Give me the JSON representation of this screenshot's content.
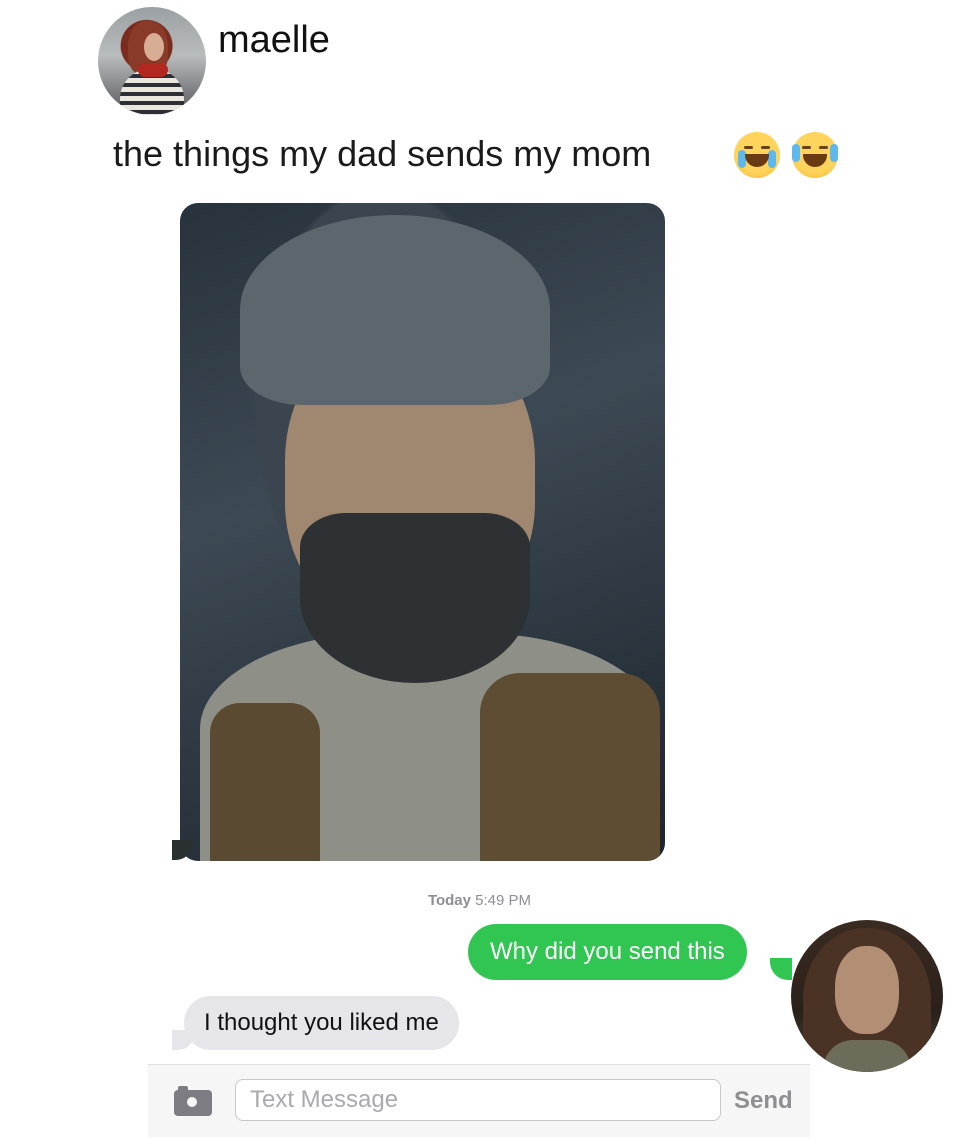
{
  "post": {
    "username": "maelle",
    "caption": "the things my dad sends my mom"
  },
  "emojis": [
    "loudly-crying-face-icon",
    "face-with-tears-of-joy-icon"
  ],
  "conversation": {
    "timestamp_day": "Today",
    "timestamp_time": "5:49 PM",
    "sent_message": "Why did you send this",
    "received_message": "I thought you liked me"
  },
  "composer": {
    "placeholder": "Text Message",
    "send_label": "Send"
  },
  "colors": {
    "sent_bubble": "#31c552",
    "received_bubble": "#e5e5ea"
  }
}
